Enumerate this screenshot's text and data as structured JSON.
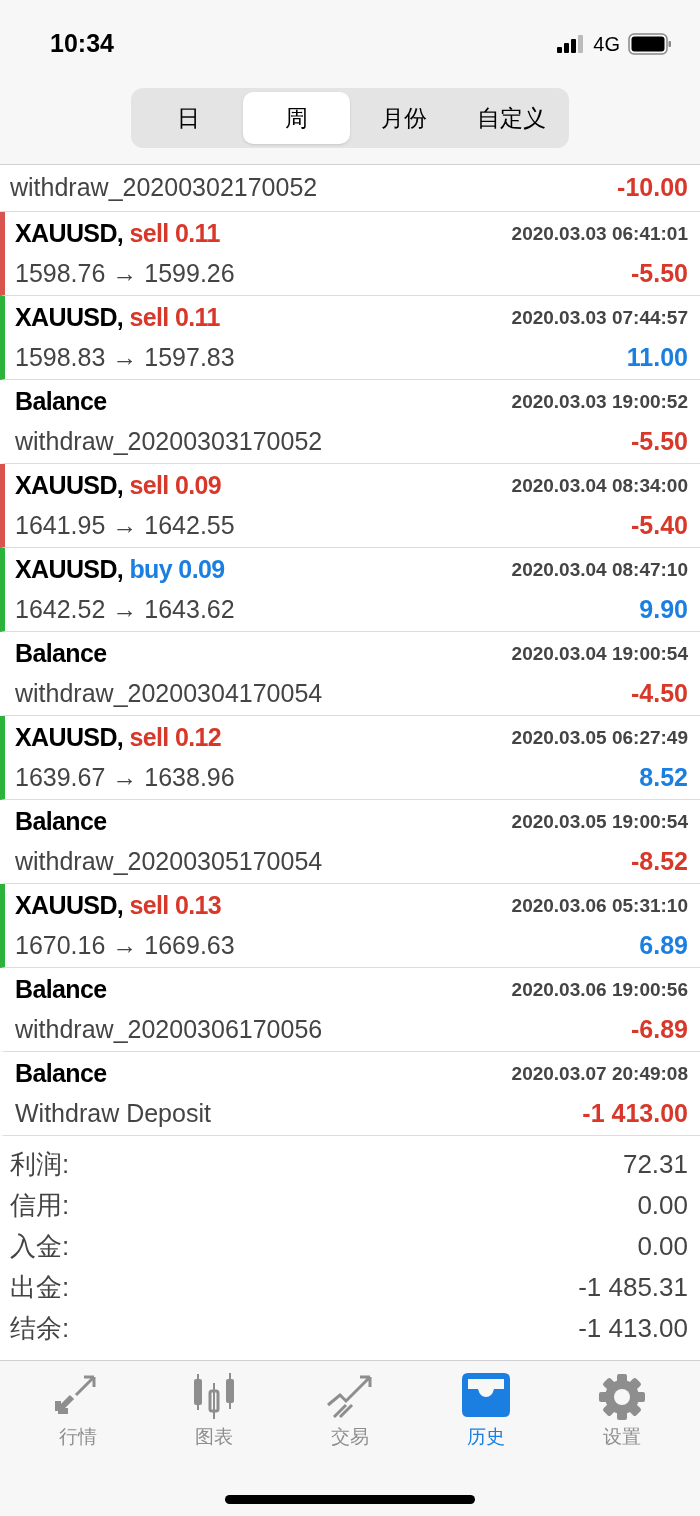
{
  "status_bar": {
    "time": "10:34",
    "network": "4G"
  },
  "period_tabs": [
    {
      "label": "日",
      "selected": false
    },
    {
      "label": "周",
      "selected": true
    },
    {
      "label": "月份",
      "selected": false
    },
    {
      "label": "自定义",
      "selected": false
    }
  ],
  "history": [
    {
      "kind": "partial",
      "comment": "withdraw_20200302170052",
      "amount": "-10.00",
      "gain": false
    },
    {
      "kind": "trade",
      "symbol": "XAUUSD,",
      "side": {
        "text": "sell 0.11",
        "color": "#d8382a"
      },
      "time": "2020.03.03 06:41:01",
      "prices": "1598.76 → 1599.26",
      "amount": "-5.50",
      "gain": false
    },
    {
      "kind": "trade",
      "symbol": "XAUUSD,",
      "side": {
        "text": "sell 0.11",
        "color": "#d8382a"
      },
      "time": "2020.03.03 07:44:57",
      "prices": "1598.83 → 1597.83",
      "amount": "11.00",
      "gain": true
    },
    {
      "kind": "balance",
      "title": "Balance",
      "time": "2020.03.03 19:00:52",
      "comment": "withdraw_20200303170052",
      "amount": "-5.50",
      "gain": false
    },
    {
      "kind": "trade",
      "symbol": "XAUUSD,",
      "side": {
        "text": "sell 0.09",
        "color": "#d8382a"
      },
      "time": "2020.03.04 08:34:00",
      "prices": "1641.95 → 1642.55",
      "amount": "-5.40",
      "gain": false
    },
    {
      "kind": "trade",
      "symbol": "XAUUSD,",
      "side": {
        "text": "buy 0.09",
        "color": "#1a7fe0"
      },
      "time": "2020.03.04 08:47:10",
      "prices": "1642.52 → 1643.62",
      "amount": "9.90",
      "gain": true
    },
    {
      "kind": "balance",
      "title": "Balance",
      "time": "2020.03.04 19:00:54",
      "comment": "withdraw_20200304170054",
      "amount": "-4.50",
      "gain": false
    },
    {
      "kind": "trade",
      "symbol": "XAUUSD,",
      "side": {
        "text": "sell 0.12",
        "color": "#d8382a"
      },
      "time": "2020.03.05 06:27:49",
      "prices": "1639.67 → 1638.96",
      "amount": "8.52",
      "gain": true
    },
    {
      "kind": "balance",
      "title": "Balance",
      "time": "2020.03.05 19:00:54",
      "comment": "withdraw_20200305170054",
      "amount": "-8.52",
      "gain": false
    },
    {
      "kind": "trade",
      "symbol": "XAUUSD,",
      "side": {
        "text": "sell 0.13",
        "color": "#d8382a"
      },
      "time": "2020.03.06 05:31:10",
      "prices": "1670.16 → 1669.63",
      "amount": "6.89",
      "gain": true
    },
    {
      "kind": "balance",
      "title": "Balance",
      "time": "2020.03.06 19:00:56",
      "comment": "withdraw_20200306170056",
      "amount": "-6.89",
      "gain": false
    },
    {
      "kind": "balance",
      "title": "Balance",
      "time": "2020.03.07 20:49:08",
      "comment": "Withdraw Deposit",
      "amount": "-1 413.00",
      "gain": false
    }
  ],
  "summary": [
    {
      "label": "利润:",
      "value": "72.31"
    },
    {
      "label": "信用:",
      "value": "0.00"
    },
    {
      "label": "入金:",
      "value": "0.00"
    },
    {
      "label": "出金:",
      "value": "-1 485.31"
    },
    {
      "label": "结余:",
      "value": "-1 413.00"
    }
  ],
  "bottom_tabs": [
    {
      "label": "行情",
      "selected": false
    },
    {
      "label": "图表",
      "selected": false
    },
    {
      "label": "交易",
      "selected": false
    },
    {
      "label": "历史",
      "selected": true
    },
    {
      "label": "设置",
      "selected": false
    }
  ]
}
